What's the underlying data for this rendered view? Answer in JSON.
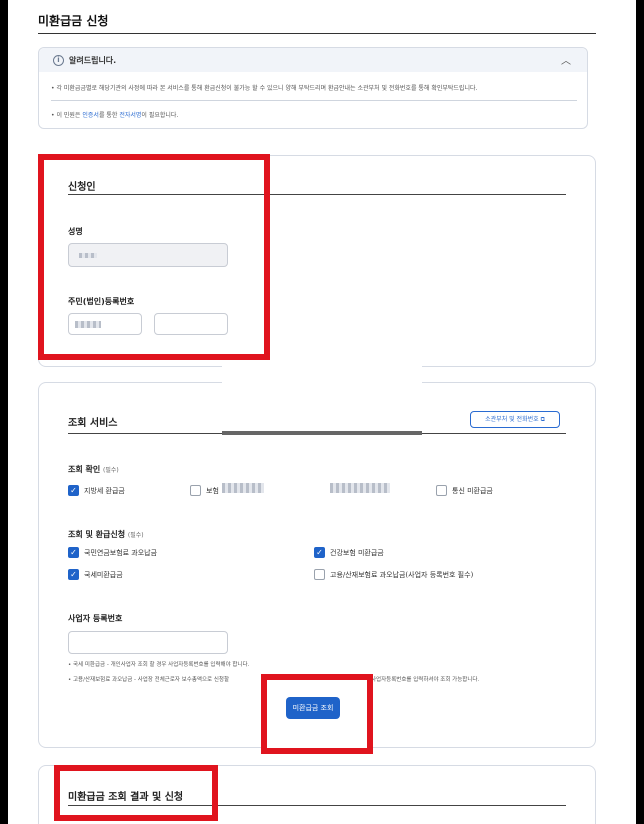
{
  "page": {
    "title": "미환급금 신청"
  },
  "notice": {
    "title": "알려드립니다.",
    "info_icon": "i",
    "chevron": "︿",
    "line1": "각 미환급금별로 해당기관의 사정에 따라 본 서비스를 통해 환급신청이 불가능 할 수 있으니 양해 부탁드리며 환급안내는 소관부처 및 전화번호를 통해 확인부탁드립니다.",
    "line2_pre": "이 민원은",
    "line2_link1": "인증서",
    "line2_mid": "를 통한",
    "line2_link2": "전자서명",
    "line2_post": "이 필요합니다."
  },
  "applicant": {
    "title": "신청인",
    "name_label": "성명",
    "id_label": "주민(법인)등록번호"
  },
  "inquiry": {
    "title": "조회 서비스",
    "ministry_button": "소관부처 및 전화번호",
    "confirm_label": "조회 확인",
    "required": "(필수)",
    "confirm_options": [
      {
        "label": "지방세 환급금",
        "checked": true
      },
      {
        "label": "보험",
        "checked": false
      },
      {
        "label": "통신 미환급금",
        "checked": false
      }
    ],
    "refund_label": "조회 및 환급신청",
    "refund_options": [
      {
        "label": "국민연금보험료 과오납금",
        "checked": true
      },
      {
        "label": "건강보험 미환급금",
        "checked": true
      },
      {
        "label": "국세미환급금",
        "checked": true
      },
      {
        "label": "고용/산재보험료 과오납금(사업자 등록번호 필수)",
        "checked": false
      }
    ],
    "bizno_label": "사업자 등록번호",
    "note1": "국세 미환급금 - 개인사업자 조회 할 경우 사업자등록번호를 입력해야 합니다.",
    "note2a": "고용/산재보험료 과오납금 - 사업장 전체근로자 보수총액으로 신청할",
    "note2b": "사업자등록번호를 입력하셔야 조회 가능합니다.",
    "search_button": "미환급금 조회"
  },
  "result": {
    "title": "미환급금 조회 결과 및 신청"
  },
  "colors": {
    "accent": "#1f63c9",
    "highlight": "#e0141e"
  }
}
